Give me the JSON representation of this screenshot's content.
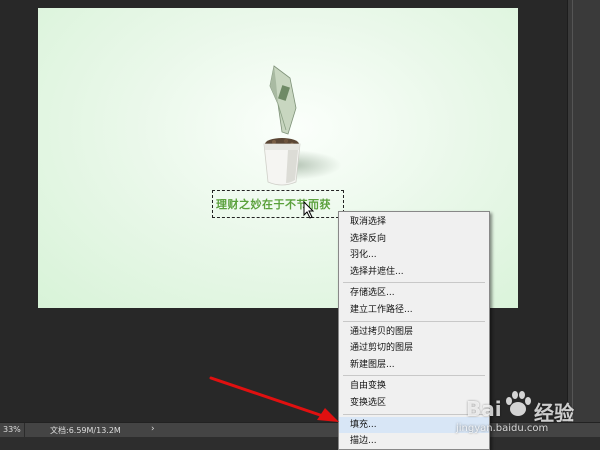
{
  "canvas": {
    "slogan": "理财之妙在于不节而获"
  },
  "context_menu": {
    "items": [
      "取消选择",
      "选择反向",
      "羽化...",
      "选择并遮住...",
      "存储选区...",
      "建立工作路径...",
      "通过拷贝的图层",
      "通过剪切的图层",
      "新建图层...",
      "自由变换",
      "变换选区",
      "填充...",
      "描边..."
    ]
  },
  "statusbar": {
    "zoom": "33%",
    "doc_info": "文档:6.59M/13.2M",
    "expand_glyph": "›"
  },
  "watermark": {
    "brand_left": "Bai",
    "brand_right": "经验",
    "url": "jingyan.baidu.com"
  },
  "colors": {
    "arrow": "#e01010",
    "slogan": "#5aa13c",
    "menu_bg": "#f0f0f0"
  },
  "icons": {
    "cursor": "arrow-cursor-icon",
    "plant": "money-plant-pot-icon",
    "watermark": "baidu-paw-icon"
  }
}
